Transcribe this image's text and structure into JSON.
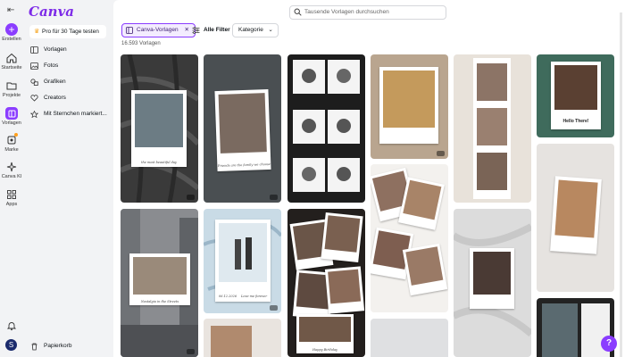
{
  "app": {
    "logo": "Canva"
  },
  "rail": {
    "items": [
      {
        "label": "Erstellen"
      },
      {
        "label": "Startseite"
      },
      {
        "label": "Projekte"
      },
      {
        "label": "Vorlagen"
      },
      {
        "label": "Marke"
      },
      {
        "label": "Canva KI"
      },
      {
        "label": "Apps"
      }
    ],
    "avatar_initial": "S"
  },
  "panel": {
    "pro_button": "Pro für 30 Tage testen",
    "nav": [
      {
        "label": "Vorlagen",
        "icon": "template-icon"
      },
      {
        "label": "Fotos",
        "icon": "photo-icon"
      },
      {
        "label": "Grafiken",
        "icon": "shapes-icon"
      },
      {
        "label": "Creators",
        "icon": "heart-icon"
      },
      {
        "label": "Mit Sternchen markiert...",
        "icon": "star-icon"
      }
    ],
    "trash": "Papierkorb"
  },
  "main": {
    "search_placeholder": "Tausende Vorlagen durchsuchen",
    "chip_selected": "Canva-Vorlagen",
    "chip_filter": "Alle Filter",
    "chip_category": "Kategorie",
    "result_count": "16.593 Vorlagen"
  },
  "cards": {
    "c1_caption": "the most beautiful day",
    "c2_caption": "Friends are the family we choose",
    "c6_caption": "Hello There!",
    "c7_caption": "Nostalgia in the Streets",
    "c8_caption_left": "06.12.2026",
    "c8_caption_right": "Love me forever",
    "c11_caption": "Happy Birthday"
  },
  "help": "?"
}
